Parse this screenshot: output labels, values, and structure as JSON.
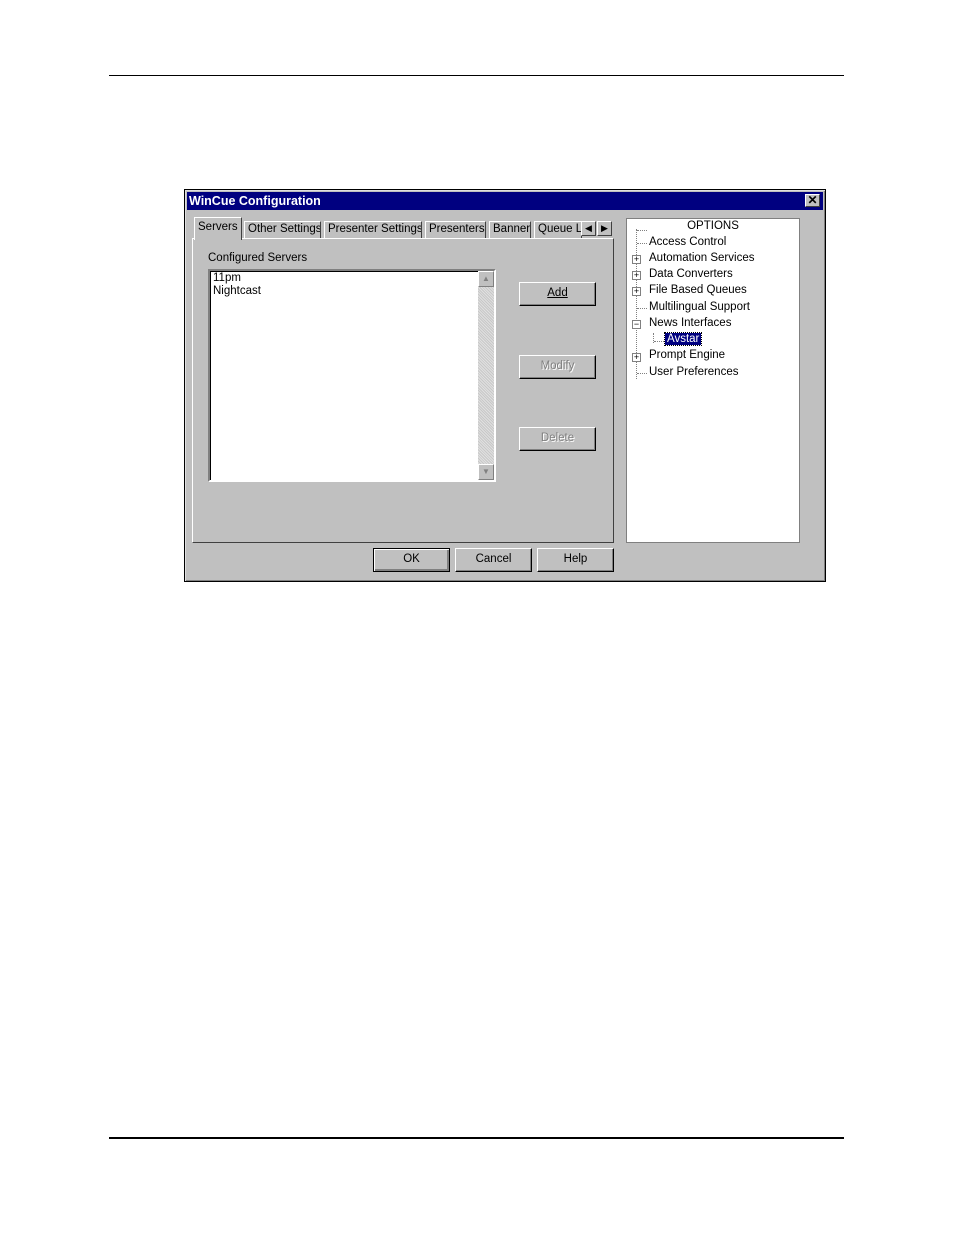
{
  "dialog": {
    "title": "WinCue Configuration",
    "close_glyph": "✕"
  },
  "tabs": [
    {
      "label": "Servers",
      "active": true
    },
    {
      "label": "Other Settings"
    },
    {
      "label": "Presenter Settings"
    },
    {
      "label": "Presenters"
    },
    {
      "label": "Banner"
    },
    {
      "label": "Queue L"
    }
  ],
  "tab_scroll": {
    "left": "◀",
    "right": "▶"
  },
  "servers": {
    "label": "Configured Servers",
    "items": [
      "11pm",
      "Nightcast"
    ],
    "scroll_up": "▲",
    "scroll_down": "▼",
    "add_label": "Add",
    "modify_label": "Modify",
    "delete_label": "Delete"
  },
  "options": {
    "title": "OPTIONS",
    "items": [
      {
        "label": "Access Control",
        "expander": ""
      },
      {
        "label": "Automation Services",
        "expander": "+"
      },
      {
        "label": "Data Converters",
        "expander": "+"
      },
      {
        "label": "File Based Queues",
        "expander": "+"
      },
      {
        "label": "Multilingual Support",
        "expander": ""
      },
      {
        "label": "News Interfaces",
        "expander": "−"
      },
      {
        "label": "Avstar",
        "expander": "",
        "child": true,
        "selected": true
      },
      {
        "label": "Prompt Engine",
        "expander": "+"
      },
      {
        "label": "User Preferences",
        "expander": ""
      }
    ]
  },
  "footer": {
    "ok_label": "OK",
    "cancel_label": "Cancel",
    "help_label": "Help"
  }
}
